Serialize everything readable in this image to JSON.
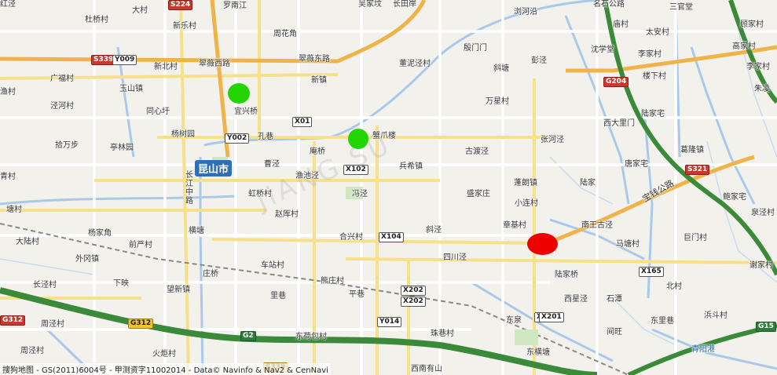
{
  "city": "昆山市",
  "copyright": "搜狗地图 - GS(2011)6004号 - 甲测资字11002014 - Data© Navinfo & Nav2 & CenNavi",
  "markers": {
    "green": "#22d400",
    "red": "#ee0000"
  },
  "place_labels": [
    "杜桥村",
    "大村",
    "新乐村",
    "罗南江",
    "周花角",
    "吴家坟",
    "长田岸",
    "浏河沿",
    "名石公路",
    "三官堂",
    "顾家村",
    "新北村",
    "翠薇西路",
    "翠薇东路",
    "董泥泾村",
    "殷门门",
    "庙村",
    "沈学堂",
    "太安村",
    "李家村",
    "李家村",
    "高家村",
    "广福村",
    "玉山镇",
    "新镇",
    "新镇",
    "斜塘",
    "彭泾",
    "楼下村",
    "朱凌",
    "渔村",
    "泾河村",
    "同心圩",
    "宜兴桥",
    "万星村",
    "陆家宅",
    "杨树园",
    "孔巷",
    "庵桥",
    "蟹爪楼",
    "西大里门",
    "葛隆镇",
    "拾万步",
    "亭林园",
    "曹泾",
    "古渡泾",
    "张河泾",
    "唐家宅",
    "青村",
    "渔池泾",
    "兵希镇",
    "蓬朗镇",
    "陆家",
    "虹桥村",
    "冯泾",
    "盛家庄",
    "小连村",
    "鲍家宅",
    "塘村",
    "赵厍村",
    "斜泾",
    "章基村",
    "南王古泾",
    "泉泾村",
    "大陆村",
    "杨家角",
    "横塘",
    "合兴村",
    "四川泾",
    "马塘村",
    "巨门村",
    "外冈镇",
    "前严村",
    "车站村",
    "陆家桥",
    "谢家村",
    "长泾村",
    "下映",
    "熊庄村",
    "平巷",
    "西星泾",
    "石潭",
    "北村",
    "望新镇",
    "里巷",
    "东里巷",
    "周泾村",
    "东泉",
    "间旺",
    "浜斗村",
    "周泾村",
    "火炬村",
    "东荷包村",
    "珠巷村",
    "东横塘",
    "西南有山",
    "庄桥",
    "青阳港",
    "红泾"
  ],
  "vertical_road": "长江中路",
  "road_diag_1": "宝钱公路",
  "shields": {
    "red": [
      "S224",
      "S339",
      "G204",
      "S321",
      "G312"
    ],
    "white": [
      "Y009",
      "X201",
      "X01",
      "Y002",
      "X102",
      "X104",
      "X165",
      "X202",
      "X202",
      "Y014",
      "X201"
    ],
    "green": [
      "G2",
      "G15"
    ],
    "yellow": [
      "G312",
      "S339"
    ]
  },
  "watermark": "JIANG SU"
}
